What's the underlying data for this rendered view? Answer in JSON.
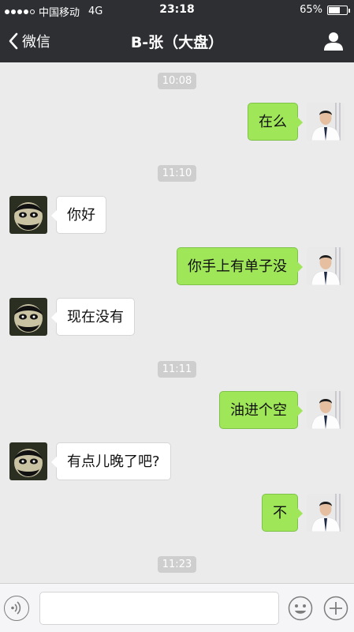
{
  "status_bar": {
    "carrier": "中国移动",
    "network": "4G",
    "time": "23:18",
    "battery_percent": "65%",
    "battery_level": 0.65,
    "signal_bars_filled": 4,
    "signal_bars_total": 5
  },
  "nav": {
    "back_label": "微信",
    "title": "B-张（大盘）",
    "profile_icon": "person-icon"
  },
  "chat": {
    "timestamps": [
      "10:08",
      "11:10",
      "11:11",
      "11:23"
    ],
    "messages": [
      {
        "side": "sent",
        "text": "在么"
      },
      {
        "side": "recv",
        "text": "你好"
      },
      {
        "side": "sent",
        "text": "你手上有单子没"
      },
      {
        "side": "recv",
        "text": "现在没有"
      },
      {
        "side": "sent",
        "text": "油进个空"
      },
      {
        "side": "recv",
        "text": "有点儿晚了吧?"
      },
      {
        "side": "sent",
        "text": "不"
      }
    ]
  },
  "input_bar": {
    "voice_icon": "voice-icon",
    "emoji_icon": "emoji-icon",
    "plus_icon": "plus-icon",
    "text_value": ""
  },
  "colors": {
    "bar_bg": "#2d2f33",
    "chat_bg": "#ebebeb",
    "sent_bubble": "#9fe658",
    "recv_bubble": "#ffffff",
    "timestamp_bg": "#cecece"
  }
}
